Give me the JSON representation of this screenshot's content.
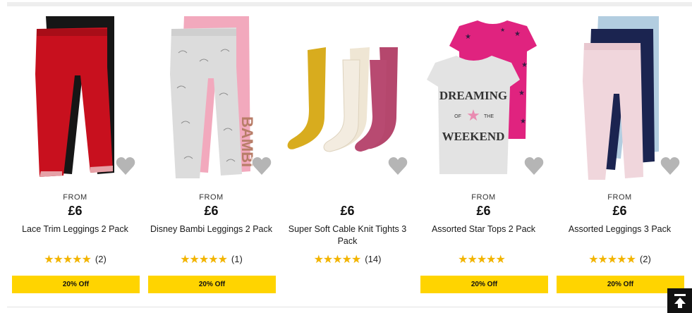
{
  "products": [
    {
      "from": "FROM",
      "price": "£6",
      "title": "Lace Trim Leggings 2 Pack",
      "stars": "★★★★★",
      "reviews": "(2)",
      "offer": "20% Off",
      "image": "red-black-leggings-image"
    },
    {
      "from": "FROM",
      "price": "£6",
      "title": "Disney Bambi Leggings 2 Pack",
      "stars": "★★★★★",
      "reviews": "(1)",
      "offer": "20% Off",
      "image": "bambi-leggings-image",
      "print": "BAMBI"
    },
    {
      "from": "",
      "price": "£6",
      "title": "Super Soft Cable Knit Tights 3 Pack",
      "stars": "★★★★★",
      "reviews": "(14)",
      "offer": "",
      "image": "cable-knit-tights-image"
    },
    {
      "from": "FROM",
      "price": "£6",
      "title": "Assorted Star Tops 2 Pack",
      "stars": "★★★★★",
      "reviews": "",
      "offer": "20% Off",
      "image": "star-tops-image",
      "print": {
        "line1": "DREAMING",
        "of": "OF",
        "the": "THE",
        "line3": "WEEKEND"
      }
    },
    {
      "from": "FROM",
      "price": "£6",
      "title": "Assorted Leggings 3 Pack",
      "stars": "★★★★★",
      "reviews": "(2)",
      "offer": "20% Off",
      "image": "assorted-leggings-image"
    }
  ],
  "colors": {
    "offer_badge": "#ffd400",
    "stars": "#f2b400",
    "favourite": "#b5b5b5"
  },
  "icons": {
    "favourite": "heart-icon",
    "back_to_top": "back-to-top-icon"
  }
}
